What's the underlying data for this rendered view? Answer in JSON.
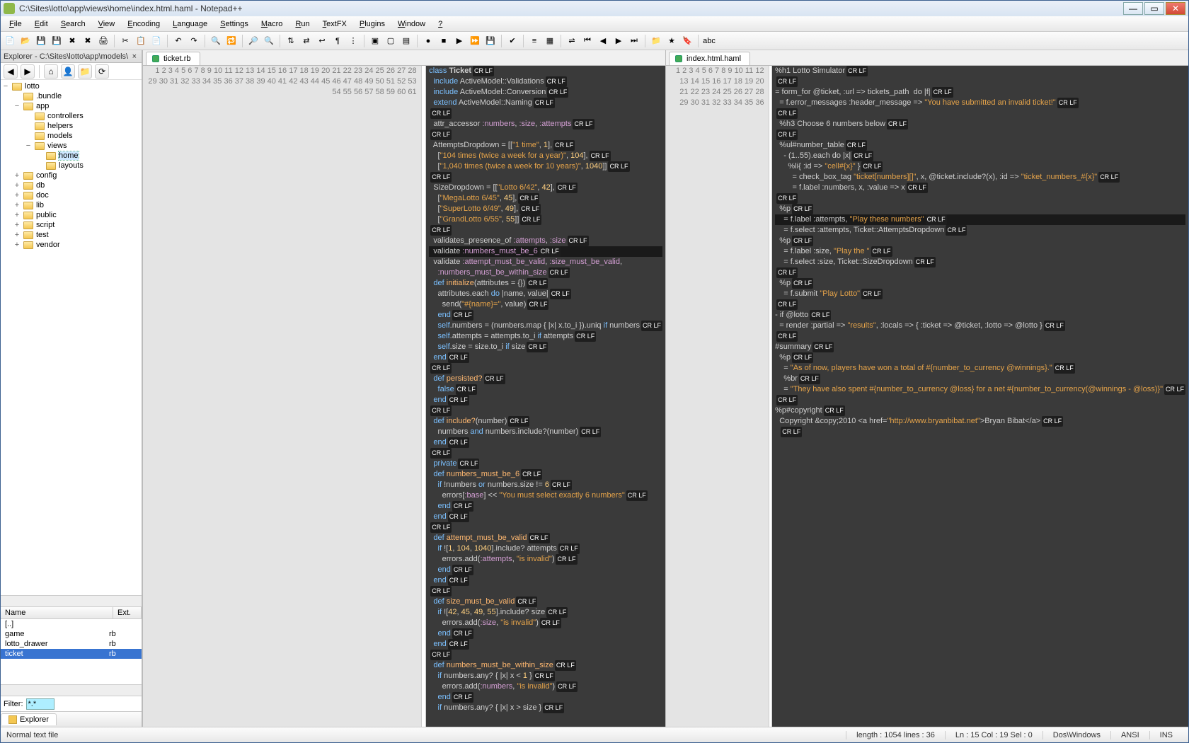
{
  "window": {
    "title": "C:\\Sites\\lotto\\app\\views\\home\\index.html.haml - Notepad++",
    "min": "—",
    "max": "▭",
    "close": "✕"
  },
  "menu": [
    "File",
    "Edit",
    "Search",
    "View",
    "Encoding",
    "Language",
    "Settings",
    "Macro",
    "Run",
    "TextFX",
    "Plugins",
    "Window",
    "?"
  ],
  "sidebar": {
    "header": "Explorer - C:\\Sites\\lotto\\app\\models\\",
    "close": "×",
    "root": "lotto",
    "nodes": [
      {
        "indent": 1,
        "label": ".bundle"
      },
      {
        "indent": 1,
        "label": "app",
        "open": true
      },
      {
        "indent": 2,
        "label": "controllers"
      },
      {
        "indent": 2,
        "label": "helpers"
      },
      {
        "indent": 2,
        "label": "models"
      },
      {
        "indent": 2,
        "label": "views",
        "open": true
      },
      {
        "indent": 3,
        "label": "home",
        "sel": true
      },
      {
        "indent": 3,
        "label": "layouts"
      },
      {
        "indent": 1,
        "label": "config",
        "plus": true
      },
      {
        "indent": 1,
        "label": "db",
        "plus": true
      },
      {
        "indent": 1,
        "label": "doc",
        "plus": true
      },
      {
        "indent": 1,
        "label": "lib",
        "plus": true
      },
      {
        "indent": 1,
        "label": "public",
        "plus": true
      },
      {
        "indent": 1,
        "label": "script",
        "plus": true
      },
      {
        "indent": 1,
        "label": "test",
        "plus": true
      },
      {
        "indent": 1,
        "label": "vendor",
        "plus": true
      }
    ],
    "fileheader": {
      "name": "Name",
      "ext": "Ext."
    },
    "files": [
      {
        "name": "[..]",
        "ext": ""
      },
      {
        "name": "game",
        "ext": "rb"
      },
      {
        "name": "lotto_drawer",
        "ext": "rb"
      },
      {
        "name": "ticket",
        "ext": "rb",
        "sel": true
      }
    ],
    "filter_label": "Filter:",
    "filter_value": "*.*",
    "explorer_tab": "Explorer"
  },
  "editors": {
    "left": {
      "tab": "ticket.rb",
      "lines": [
        "<span class='k'>class</span> <span class='cl'>Ticket</span><span class='crlf'>CR LF</span>",
        "  <span class='k'>include</span> ActiveModel::Validations<span class='crlf'>CR LF</span>",
        "  <span class='k'>include</span> ActiveModel::Conversion<span class='crlf'>CR LF</span>",
        "  <span class='k'>extend</span> ActiveModel::Naming<span class='crlf'>CR LF</span>",
        "<span class='crlf'>CR LF</span>",
        "  attr_accessor <span class='sy'>:numbers</span>, <span class='sy'>:size</span>, <span class='sy'>:attempts</span><span class='crlf'>CR LF</span>",
        "<span class='crlf'>CR LF</span>",
        "  AttemptsDropdown = [[<span class='s'>\"1 time\"</span>, <span class='n'>1</span>],<span class='crlf'>CR LF</span>",
        "    [<span class='s'>\"104 times (twice a week for a year)\"</span>, <span class='n'>104</span>],<span class='crlf'>CR LF</span>",
        "    [<span class='s'>\"1,040 times (twice a week for 10 years)\"</span>, <span class='n'>1040</span>]]<span class='crlf'>CR LF</span>",
        "<span class='crlf'>CR LF</span>",
        "  SizeDropdown = [[<span class='s'>\"Lotto 6/42\"</span>, <span class='n'>42</span>],<span class='crlf'>CR LF</span>",
        "    [<span class='s'>\"MegaLotto 6/45\"</span>, <span class='n'>45</span>],<span class='crlf'>CR LF</span>",
        "    [<span class='s'>\"SuperLotto 6/49\"</span>, <span class='n'>49</span>],<span class='crlf'>CR LF</span>",
        "    [<span class='s'>\"GrandLotto 6/55\"</span>, <span class='n'>55</span>]]<span class='crlf'>CR LF</span>",
        "<span class='crlf'>CR LF</span>",
        "  validates_presence_of <span class='sy'>:attempts</span>, <span class='sy'>:size</span><span class='crlf'>CR LF</span>",
        "<span class='hl'>  validate <span class='sy'>:numbers_must_be_6</span><span class='crlf'>CR LF</span></span>",
        "  validate <span class='sy'>:attempt_must_be_valid</span>, <span class='sy'>:size_must_be_valid</span>,",
        "    <span class='sy'>:numbers_must_be_within_size</span><span class='crlf'>CR LF</span>",
        "  <span class='k'>def</span> <span class='fn'>initialize</span>(attributes = {})<span class='crlf'>CR LF</span>",
        "    attributes.each <span class='k'>do</span> |name, value|<span class='crlf'>CR LF</span>",
        "      send(<span class='s'>\"#{name}=\"</span>, value)<span class='crlf'>CR LF</span>",
        "    <span class='k'>end</span><span class='crlf'>CR LF</span>",
        "    <span class='k'>self</span>.numbers = (numbers.map { |x| x.to_i }).uniq <span class='k'>if</span> numbers<span class='crlf'>CR LF</span>",
        "    <span class='k'>self</span>.attempts = attempts.to_i <span class='k'>if</span> attempts<span class='crlf'>CR LF</span>",
        "    <span class='k'>self</span>.size = size.to_i <span class='k'>if</span> size<span class='crlf'>CR LF</span>",
        "  <span class='k'>end</span><span class='crlf'>CR LF</span>",
        "<span class='crlf'>CR LF</span>",
        "  <span class='k'>def</span> <span class='fn'>persisted?</span><span class='crlf'>CR LF</span>",
        "    <span class='k'>false</span><span class='crlf'>CR LF</span>",
        "  <span class='k'>end</span><span class='crlf'>CR LF</span>",
        "<span class='crlf'>CR LF</span>",
        "  <span class='k'>def</span> <span class='fn'>include?</span>(number)<span class='crlf'>CR LF</span>",
        "    numbers <span class='k'>and</span> numbers.include?(number)<span class='crlf'>CR LF</span>",
        "  <span class='k'>end</span><span class='crlf'>CR LF</span>",
        "<span class='crlf'>CR LF</span>",
        "  <span class='k'>private</span><span class='crlf'>CR LF</span>",
        "  <span class='k'>def</span> <span class='fn'>numbers_must_be_6</span><span class='crlf'>CR LF</span>",
        "    <span class='k'>if</span> !numbers <span class='k'>or</span> numbers.size != <span class='n'>6</span><span class='crlf'>CR LF</span>",
        "      errors[<span class='sy'>:base</span>] &lt;&lt; <span class='s'>\"You must select exactly 6 numbers\"</span><span class='crlf'>CR LF</span>",
        "    <span class='k'>end</span><span class='crlf'>CR LF</span>",
        "  <span class='k'>end</span><span class='crlf'>CR LF</span>",
        "<span class='crlf'>CR LF</span>",
        "  <span class='k'>def</span> <span class='fn'>attempt_must_be_valid</span><span class='crlf'>CR LF</span>",
        "    <span class='k'>if</span> ![<span class='n'>1</span>, <span class='n'>104</span>, <span class='n'>1040</span>].include? attempts<span class='crlf'>CR LF</span>",
        "      errors.add(<span class='sy'>:attempts</span>, <span class='s'>\"is invalid\"</span>)<span class='crlf'>CR LF</span>",
        "    <span class='k'>end</span><span class='crlf'>CR LF</span>",
        "  <span class='k'>end</span><span class='crlf'>CR LF</span>",
        "<span class='crlf'>CR LF</span>",
        "  <span class='k'>def</span> <span class='fn'>size_must_be_valid</span><span class='crlf'>CR LF</span>",
        "    <span class='k'>if</span> ![<span class='n'>42</span>, <span class='n'>45</span>, <span class='n'>49</span>, <span class='n'>55</span>].include? size<span class='crlf'>CR LF</span>",
        "      errors.add(<span class='sy'>:size</span>, <span class='s'>\"is invalid\"</span>)<span class='crlf'>CR LF</span>",
        "    <span class='k'>end</span><span class='crlf'>CR LF</span>",
        "  <span class='k'>end</span><span class='crlf'>CR LF</span>",
        "<span class='crlf'>CR LF</span>",
        "  <span class='k'>def</span> <span class='fn'>numbers_must_be_within_size</span><span class='crlf'>CR LF</span>",
        "    <span class='k'>if</span> numbers.any? { |x| x &lt; <span class='n'>1</span> }<span class='crlf'>CR LF</span>",
        "      errors.add(<span class='sy'>:numbers</span>, <span class='s'>\"is invalid\"</span>)<span class='crlf'>CR LF</span>",
        "    <span class='k'>end</span><span class='crlf'>CR LF</span>",
        "    <span class='k'>if</span> numbers.any? { |x| x &gt; size }<span class='crlf'>CR LF</span>"
      ]
    },
    "right": {
      "tab": "index.html.haml",
      "lines": [
        "%h1 Lotto Simulator<span class='crlf'>CR LF</span>",
        "<span class='crlf'>CR LF</span>",
        "= form_for @ticket, :url =&gt; tickets_path  do |f|<span class='crlf'>CR LF</span>",
        "  = f.error_messages :header_message =&gt; <span class='s'>\"You have submitted an invalid ticket!\"</span><span class='crlf'>CR LF</span>",
        "<span class='crlf'>CR LF</span>",
        "  %h3 Choose 6 numbers below<span class='crlf'>CR LF</span>",
        "<span class='crlf'>CR LF</span>",
        "  %ul#number_table<span class='crlf'>CR LF</span>",
        "    - (1..55).each do |x|<span class='crlf'>CR LF</span>",
        "      %li{ :id =&gt; <span class='s'>\"cell#{x}\"</span> }<span class='crlf'>CR LF</span>",
        "        = check_box_tag <span class='s'>\"ticket[numbers][]\"</span>, x, @ticket.include?(x), :id =&gt; <span class='s'>\"ticket_numbers_#{x}\"</span><span class='crlf'>CR LF</span>",
        "        = f.label :numbers, x, :value =&gt; x<span class='crlf'>CR LF</span>",
        "<span class='crlf'>CR LF</span>",
        "  %p<span class='crlf'>CR LF</span>",
        "<span class='hl'>    = f.label :attempts, <span class='s'>\"Play these numbers\"</span><span class='crlf'>CR LF</span></span>",
        "    = f.select :attempts, Ticket::AttemptsDropdown<span class='crlf'>CR LF</span>",
        "  %p<span class='crlf'>CR LF</span>",
        "    = f.label :size, <span class='s'>\"Play the \"</span><span class='crlf'>CR LF</span>",
        "    = f.select :size, Ticket::SizeDropdown<span class='crlf'>CR LF</span>",
        "<span class='crlf'>CR LF</span>",
        "  %p<span class='crlf'>CR LF</span>",
        "    = f.submit <span class='s'>\"Play Lotto\"</span><span class='crlf'>CR LF</span>",
        "<span class='crlf'>CR LF</span>",
        "- if @lotto<span class='crlf'>CR LF</span>",
        "  = render :partial =&gt; <span class='s'>\"results\"</span>, :locals =&gt; { :ticket =&gt; @ticket, :lotto =&gt; @lotto }<span class='crlf'>CR LF</span>",
        "<span class='crlf'>CR LF</span>",
        "#summary<span class='crlf'>CR LF</span>",
        "  %p<span class='crlf'>CR LF</span>",
        "    = <span class='s'>\"As of now, players have won a total of #{number_to_currency @winnings}.\"</span><span class='crlf'>CR LF</span>",
        "    %br<span class='crlf'>CR LF</span>",
        "    = <span class='s'>\"They have also spent #{number_to_currency @loss} for a net #{number_to_currency(@winnings - @loss)}\"</span><span class='crlf'>CR LF</span>",
        "<span class='crlf'>CR LF</span>",
        "%p#copyright<span class='crlf'>CR LF</span>",
        "  Copyright &amp;copy;2010 &lt;a href=<span class='s'>\"http://www.bryanbibat.net\"</span>&gt;Bryan Bibat&lt;/a&gt;<span class='crlf'>CR LF</span>",
        "  <span class='crlf'>CR LF</span>",
        ""
      ]
    }
  },
  "status": {
    "filetype": "Normal text file",
    "length": "length : 1054    lines : 36",
    "pos": "Ln : 15    Col : 19    Sel : 0",
    "eol": "Dos\\Windows",
    "enc": "ANSI",
    "mode": "INS"
  },
  "toolbar_icons": [
    "new-file-icon",
    "open-file-icon",
    "save-icon",
    "save-all-icon",
    "close-icon",
    "close-all-icon",
    "print-icon",
    "sep",
    "cut-icon",
    "copy-icon",
    "paste-icon",
    "sep",
    "undo-icon",
    "redo-icon",
    "sep",
    "find-icon",
    "replace-icon",
    "sep",
    "zoom-in-icon",
    "zoom-out-icon",
    "sep",
    "sync-v-icon",
    "sync-h-icon",
    "wrap-icon",
    "show-all-chars-icon",
    "indent-guide-icon",
    "sep",
    "fold-all-icon",
    "unfold-all-icon",
    "hide-lines-icon",
    "sep",
    "macro-record-icon",
    "macro-stop-icon",
    "macro-play-icon",
    "macro-play-multi-icon",
    "macro-save-icon",
    "sep",
    "spell-check-icon",
    "sep",
    "func-list-icon",
    "doc-map-icon",
    "sep",
    "compare-icon",
    "first-diff-icon",
    "prev-diff-icon",
    "next-diff-icon",
    "last-diff-icon",
    "sep",
    "explorer-icon",
    "favorites-icon",
    "bookmark-icon",
    "sep",
    "abc-icon"
  ],
  "nav_icons": [
    "back-icon",
    "forward-icon",
    "sep",
    "home-icon",
    "user-icon",
    "new-folder-icon",
    "toggle-icon"
  ]
}
